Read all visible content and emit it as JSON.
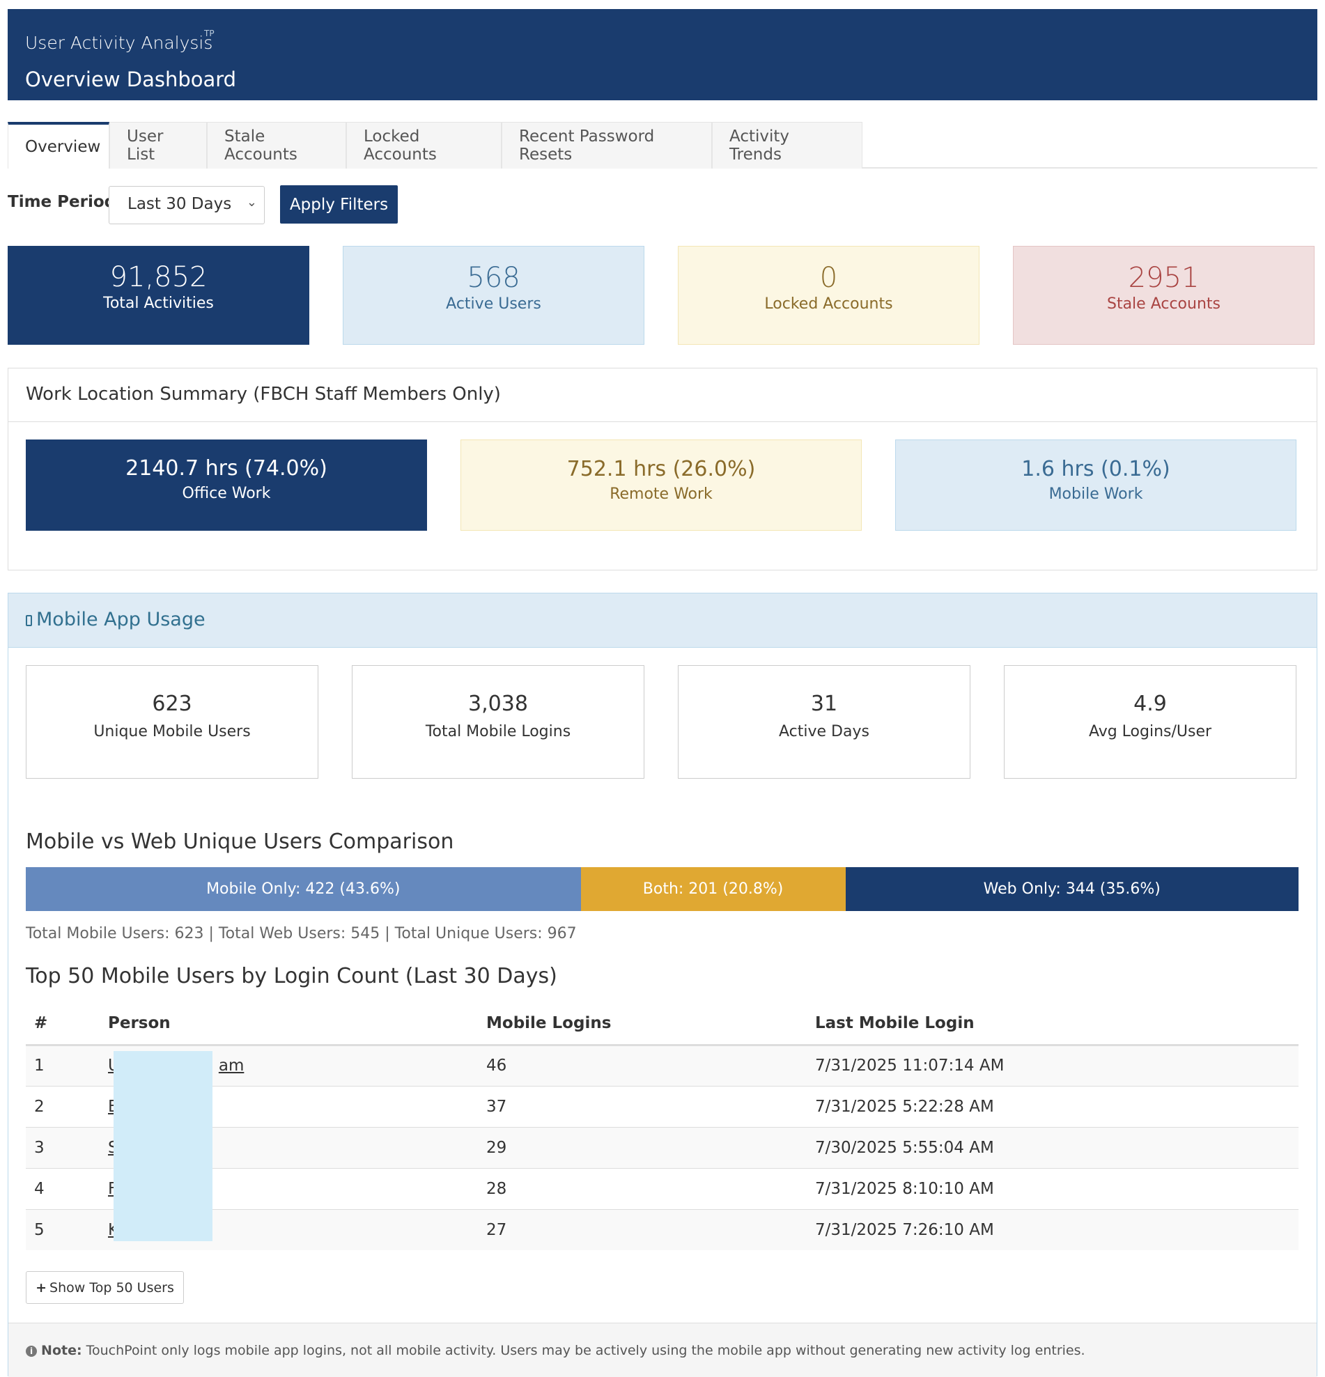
{
  "header": {
    "app_title": "User Activity Analysis",
    "logo_text": "TP",
    "page_title": "Overview Dashboard"
  },
  "tabs": [
    {
      "label": "Overview",
      "active": true
    },
    {
      "label": "User List"
    },
    {
      "label": "Stale Accounts"
    },
    {
      "label": "Locked Accounts"
    },
    {
      "label": "Recent Password Resets"
    },
    {
      "label": "Activity Trends"
    }
  ],
  "filters": {
    "time_period_label": "Time Period:",
    "time_period_value": "Last 30 Days",
    "apply_label": "Apply Filters"
  },
  "stats": [
    {
      "value": "91,852",
      "label": "Total Activities"
    },
    {
      "value": "568",
      "label": "Active Users"
    },
    {
      "value": "0",
      "label": "Locked Accounts"
    },
    {
      "value": "2951",
      "label": "Stale Accounts"
    }
  ],
  "work_location": {
    "title": "Work Location Summary (FBCH Staff Members Only)",
    "items": [
      {
        "value": "2140.7 hrs (74.0%)",
        "label": "Office Work"
      },
      {
        "value": "752.1 hrs (26.0%)",
        "label": "Remote Work"
      },
      {
        "value": "1.6 hrs (0.1%)",
        "label": "Mobile Work"
      }
    ]
  },
  "mobile": {
    "title": "Mobile App Usage",
    "stats": [
      {
        "value": "623",
        "label": "Unique Mobile Users"
      },
      {
        "value": "3,038",
        "label": "Total Mobile Logins"
      },
      {
        "value": "31",
        "label": "Active Days"
      },
      {
        "value": "4.9",
        "label": "Avg Logins/User"
      }
    ],
    "comparison_title": "Mobile vs Web Unique Users Comparison",
    "comparison": [
      {
        "label": "Mobile Only: 422 (43.6%)",
        "share": 43.6
      },
      {
        "label": "Both: 201 (20.8%)",
        "share": 20.8
      },
      {
        "label": "Web Only: 344 (35.6%)",
        "share": 35.6
      }
    ],
    "totals_text": "Total Mobile Users: 623 | Total Web Users: 545 | Total Unique Users: 967",
    "top_title": "Top 50 Mobile Users by Login Count (Last 30 Days)",
    "table": {
      "headers": [
        "#",
        "Person",
        "Mobile Logins",
        "Last Mobile Login"
      ],
      "rows": [
        [
          "1",
          "U",
          "am",
          "46",
          "7/31/2025 11:07:14 AM"
        ],
        [
          "2",
          "E",
          "",
          "37",
          "7/31/2025 5:22:28 AM"
        ],
        [
          "3",
          "S",
          "",
          "29",
          "7/30/2025 5:55:04 AM"
        ],
        [
          "4",
          "F",
          "",
          "28",
          "7/31/2025 8:10:10 AM"
        ],
        [
          "5",
          "K",
          "",
          "27",
          "7/31/2025 7:26:10 AM"
        ]
      ]
    },
    "show_button": "Show Top 50 Users",
    "note_label": "Note:",
    "note_text": "TouchPoint only logs mobile app logins, not all mobile activity. Users may be actively using the mobile app without generating new activity log entries."
  }
}
